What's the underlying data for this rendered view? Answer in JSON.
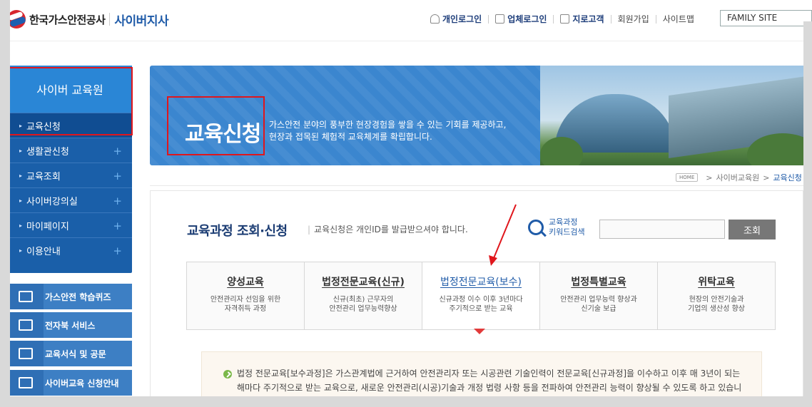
{
  "header": {
    "logo_text": "한국가스안전공사",
    "logo_sub": "사이버지사",
    "nav": [
      {
        "label": "개인로그인",
        "icon": "person-icon",
        "style": "bold"
      },
      {
        "label": "업체로그인",
        "icon": "briefcase-icon",
        "style": "bold"
      },
      {
        "label": "지로고객",
        "icon": "list-icon",
        "style": "bold"
      },
      {
        "label": "회원가입",
        "icon": "",
        "style": "plain"
      },
      {
        "label": "사이트맵",
        "icon": "",
        "style": "plain"
      }
    ],
    "family_site": "FAMILY SITE"
  },
  "sidebar": {
    "title": "사이버 교육원",
    "items": [
      {
        "label": "교육신청",
        "active": true
      },
      {
        "label": "생활관신청"
      },
      {
        "label": "교육조회"
      },
      {
        "label": "사이버강의실"
      },
      {
        "label": "마이페이지"
      },
      {
        "label": "이용안내"
      }
    ],
    "buttons": [
      {
        "label": "가스안전 학습퀴즈",
        "icon": "quiz-icon"
      },
      {
        "label": "전자북 서비스",
        "icon": "book-icon"
      },
      {
        "label": "교육서식 및 공문",
        "icon": "document-icon"
      },
      {
        "label": "사이버교육 신청안내",
        "icon": "guide-icon"
      }
    ]
  },
  "banner": {
    "title": "교육신청",
    "desc_line1": "가스안전 분야의 풍부한 현장경험을 쌓을 수 있는 기회를 제공하고,",
    "desc_line2": "현장과 접목된 체험적 교육체계를 확립합니다."
  },
  "breadcrumb": {
    "home": "HOME",
    "parent": "사이버교육원",
    "current": "교육신청",
    "sep": ">"
  },
  "main": {
    "title": "교육과정 조회·신청",
    "note": "교육신청은 개인ID를 발급받으셔야 합니다.",
    "keyword_label_1": "교육과정",
    "keyword_label_2": "키워드검색",
    "keyword_value": "",
    "search_button": "조회",
    "tabs": [
      {
        "name": "양성교육",
        "desc1": "안전관리자 선임을 위한",
        "desc2": "자격취득 과정"
      },
      {
        "name": "법정전문교육(신규)",
        "desc1": "신규(최초) 근무자의",
        "desc2": "안전관리 업무능력향상"
      },
      {
        "name": "법정전문교육(보수)",
        "desc1": "신규과정 이수 이후 3년마다",
        "desc2": "주기적으로 받는 교육",
        "active": true
      },
      {
        "name": "법정특별교육",
        "desc1": "안전관리 업무능력 향상과",
        "desc2": "신기술 보급"
      },
      {
        "name": "위탁교육",
        "desc1": "현장의 안전기술과",
        "desc2": "기업의 생산성 향상"
      }
    ],
    "notice_text": "법정 전문교육[보수과정]은 가스관계법에 근거하여 안전관리자 또는 시공관련 기술인력이 전문교육[신규과정]을 이수하고 이후 매 3년이 되는 해마다 주기적으로 받는 교육으로, 새로운 안전관리(시공)기술과 개정 법령 사항 등을 전파하여 안전관리 능력이 향상될 수 있도록 하고 있습니다."
  },
  "colors": {
    "brand_blue": "#1f5ba8",
    "sidebar_blue": "#1a5fa9",
    "annotation_red": "#e0161c"
  }
}
